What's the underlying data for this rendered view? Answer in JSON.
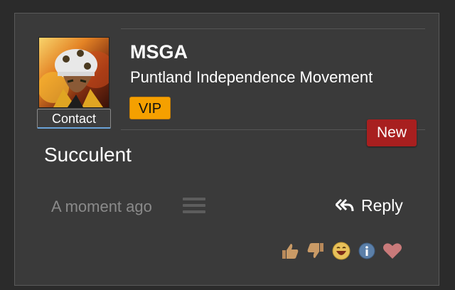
{
  "post": {
    "author": "MSGA",
    "group": "Puntland Independence Movement",
    "rank_badge": "VIP",
    "new_badge": "New",
    "contact_label": "Contact",
    "message": "Succulent",
    "timestamp": "A moment ago",
    "reply_label": "Reply"
  },
  "reactions": [
    {
      "name": "like",
      "icon": "thumbs-up-icon"
    },
    {
      "name": "dislike",
      "icon": "thumbs-down-icon"
    },
    {
      "name": "laugh",
      "icon": "laughing-face-icon"
    },
    {
      "name": "info",
      "icon": "info-icon"
    },
    {
      "name": "love",
      "icon": "heart-icon"
    }
  ],
  "colors": {
    "vip_badge": "#f5a000",
    "new_badge": "#a81f1f",
    "card_bg": "#3a3a3a"
  }
}
